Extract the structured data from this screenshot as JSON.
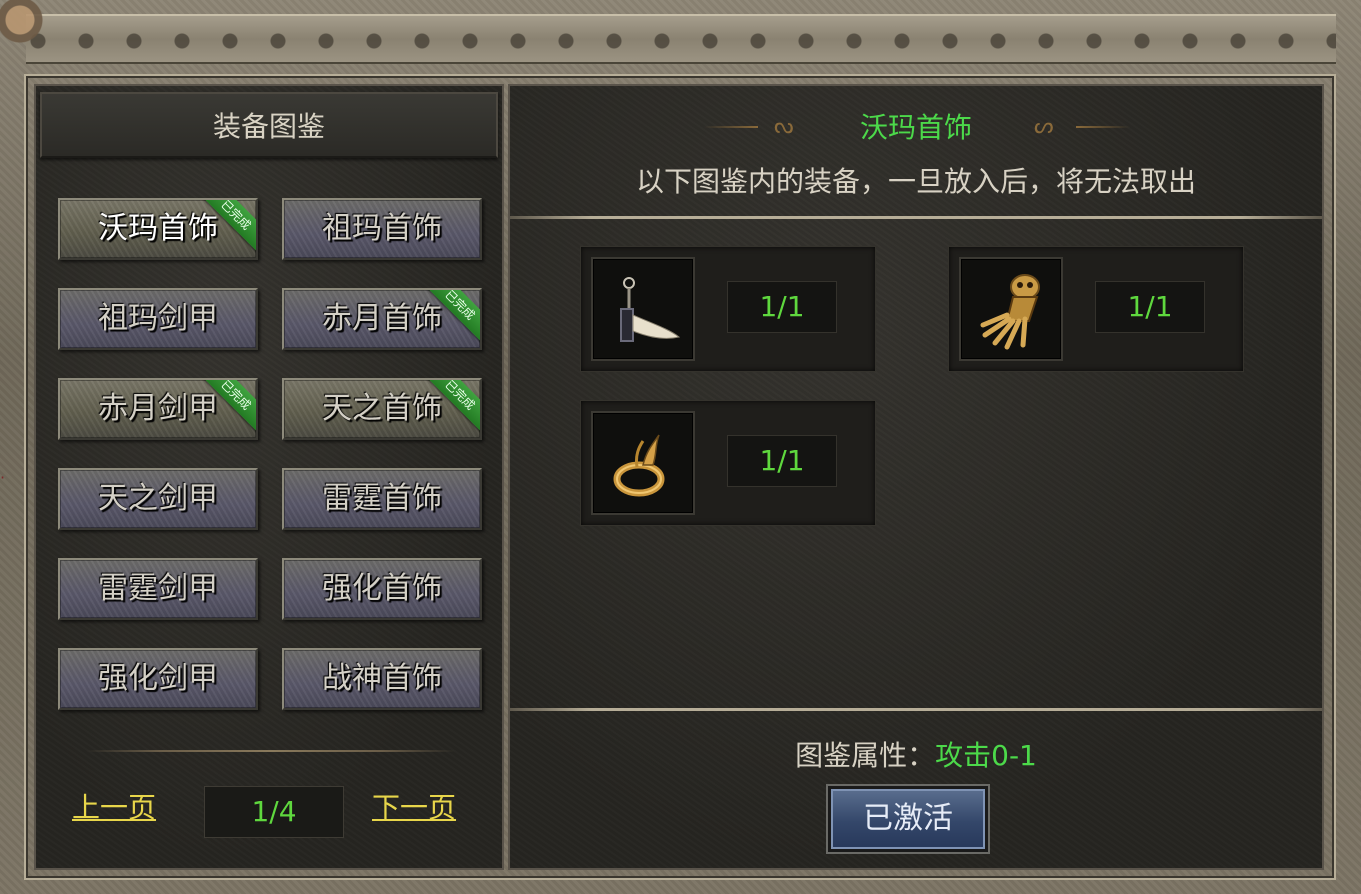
{
  "left_panel": {
    "title": "装备图鉴",
    "categories": [
      {
        "label": "沃玛首饰",
        "completed": true,
        "badge": "已完成",
        "selected": true
      },
      {
        "label": "祖玛首饰",
        "completed": false
      },
      {
        "label": "祖玛剑甲",
        "completed": false
      },
      {
        "label": "赤月首饰",
        "completed": true,
        "badge": "已完成"
      },
      {
        "label": "赤月剑甲",
        "completed": true,
        "badge": "已完成"
      },
      {
        "label": "天之首饰",
        "completed": true,
        "badge": "已完成"
      },
      {
        "label": "天之剑甲",
        "completed": false
      },
      {
        "label": "雷霆首饰",
        "completed": false
      },
      {
        "label": "雷霆剑甲",
        "completed": false
      },
      {
        "label": "强化首饰",
        "completed": false
      },
      {
        "label": "强化剑甲",
        "completed": false
      },
      {
        "label": "战神首饰",
        "completed": false
      }
    ],
    "pager": {
      "prev": "上一页",
      "page": "1/4",
      "next": "下一页"
    }
  },
  "right_panel": {
    "set_title": "沃玛首饰",
    "notice": "以下图鉴内的装备，一旦放入后，将无法取出",
    "items": [
      {
        "icon": "fang-necklace-icon",
        "count": "1/1"
      },
      {
        "icon": "skeleton-gauntlet-icon",
        "count": "1/1"
      },
      {
        "icon": "dragon-ring-icon",
        "count": "1/1"
      }
    ],
    "attribute_label": "图鉴属性：",
    "attribute_value": "攻击0-1",
    "activate_button": "已激活"
  },
  "colors": {
    "green_text": "#4cd94a",
    "count_green": "#5fd83e",
    "link_yellow": "#e8d64a",
    "badge_green": "#2f8f2f",
    "button_blue": "#34476a"
  }
}
